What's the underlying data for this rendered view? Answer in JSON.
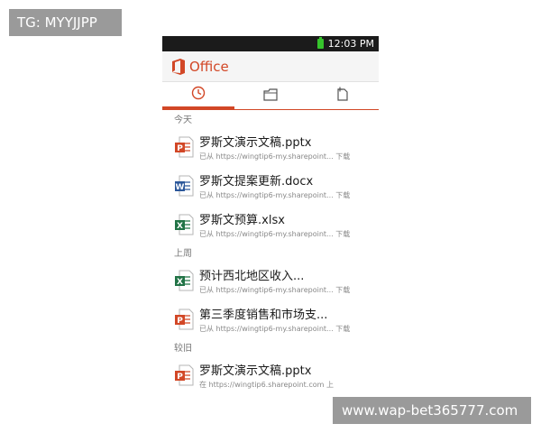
{
  "watermarks": {
    "top_left": "TG: MYYJJPP",
    "bottom_right": "www.wap-bet365777.com"
  },
  "status_bar": {
    "time": "12:03 PM",
    "battery_color": "#36c42c"
  },
  "app": {
    "title": "Office",
    "accent_color": "#d24726"
  },
  "tabs": [
    {
      "icon": "clock-icon",
      "active": true
    },
    {
      "icon": "folder-icon",
      "active": false
    },
    {
      "icon": "new-document-icon",
      "active": false
    }
  ],
  "sections": [
    {
      "header": "今天",
      "files": [
        {
          "name": "罗斯文演示文稿.pptx",
          "meta": "已从 https://wingtip6-my.sharepoint... 下载",
          "type": "powerpoint"
        },
        {
          "name": "罗斯文提案更新.docx",
          "meta": "已从 https://wingtip6-my.sharepoint... 下载",
          "type": "word"
        },
        {
          "name": "罗斯文预算.xlsx",
          "meta": "已从 https://wingtip6-my.sharepoint... 下载",
          "type": "excel"
        }
      ]
    },
    {
      "header": "上周",
      "files": [
        {
          "name": "预计西北地区收入...",
          "meta": "已从 https://wingtip6-my.sharepoint... 下载",
          "type": "excel"
        },
        {
          "name": "第三季度销售和市场支...",
          "meta": "已从 https://wingtip6-my.sharepoint... 下载",
          "type": "powerpoint"
        }
      ]
    },
    {
      "header": "较旧",
      "files": [
        {
          "name": "罗斯文演示文稿.pptx",
          "meta": "在 https://wingtip6.sharepoint.com 上",
          "type": "powerpoint"
        }
      ]
    }
  ]
}
